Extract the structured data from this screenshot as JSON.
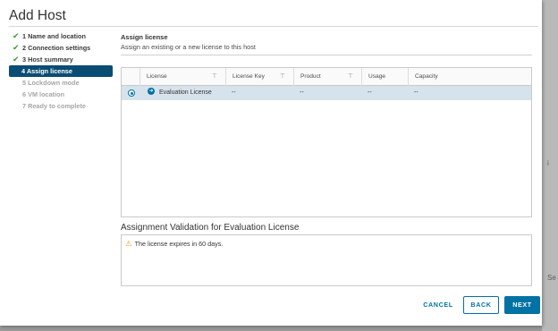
{
  "dialog": {
    "title": "Add Host"
  },
  "steps": [
    {
      "label": "1 Name and location",
      "state": "done"
    },
    {
      "label": "2 Connection settings",
      "state": "done"
    },
    {
      "label": "3 Host summary",
      "state": "done"
    },
    {
      "label": "4 Assign license",
      "state": "active"
    },
    {
      "label": "5 Lockdown mode",
      "state": "disabled"
    },
    {
      "label": "6 VM location",
      "state": "disabled"
    },
    {
      "label": "7 Ready to complete",
      "state": "disabled"
    }
  ],
  "section": {
    "title": "Assign license",
    "subtitle": "Assign an existing or a new license to this host"
  },
  "grid": {
    "columns": [
      "License",
      "License Key",
      "Product",
      "Usage",
      "Capacity"
    ],
    "rows": [
      {
        "license": "Evaluation License",
        "key": "--",
        "product": "--",
        "usage": "--",
        "capacity": "--",
        "selected": true
      }
    ]
  },
  "validation": {
    "title": "Assignment Validation for Evaluation License",
    "message": "The license expires in 60 days."
  },
  "buttons": {
    "cancel": "CANCEL",
    "back": "BACK",
    "next": "NEXT"
  },
  "colors": {
    "accent": "#0072a3",
    "active_step": "#0a4d74",
    "check": "#3f9c35",
    "warning": "#e8a21a",
    "selected_row": "#d7e3ec"
  }
}
